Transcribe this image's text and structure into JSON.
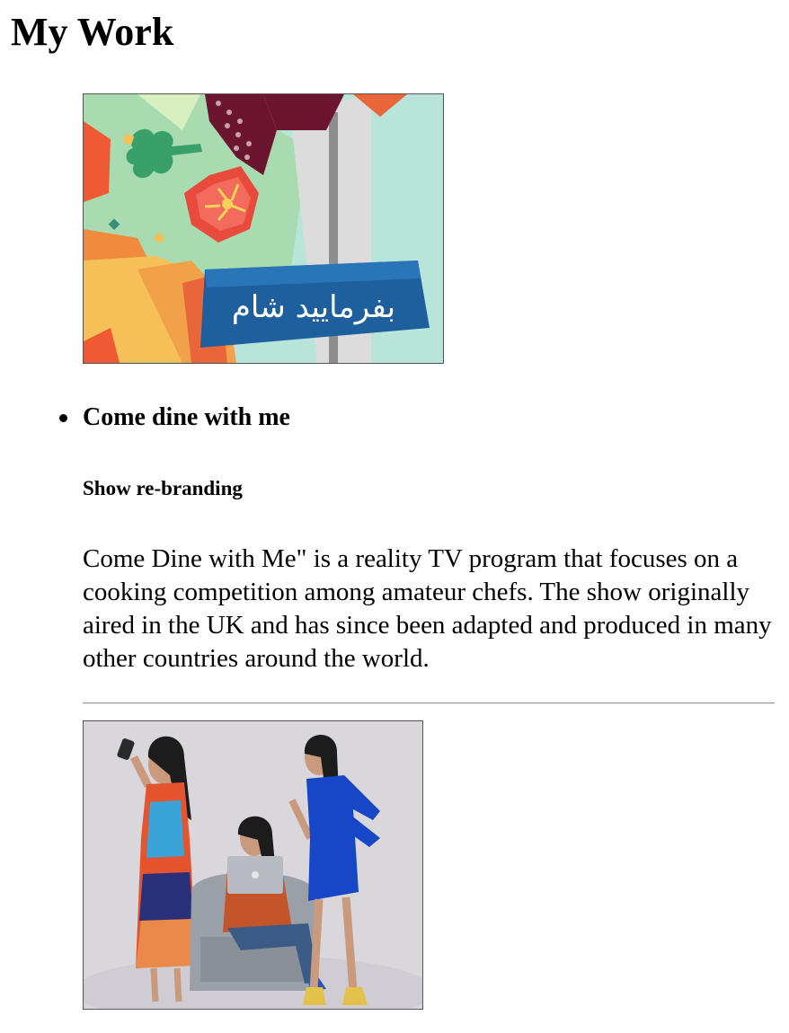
{
  "page": {
    "title": "My Work"
  },
  "works": [
    {
      "image": {
        "alt": "Come Dine with Me Persian logo artwork",
        "arabic_title": "بفرمایید شام",
        "colors": {
          "background": "#b9e4da",
          "banner": "#1e5f9e",
          "tomato": "#e84b3c",
          "orange": "#f08a3c",
          "maroon": "#6b1530",
          "leaf": "#3aa06a"
        }
      },
      "title": "Come dine with me",
      "subtitle": "Show re-branding",
      "description": "Come Dine with Me\" is a reality TV program that focuses on a cooking competition among amateur chefs. The show originally aired in the UK and has since been adapted and produced in many other countries around the world."
    },
    {
      "image": {
        "alt": "Three hosts posing: one taking a selfie, one seated with a laptop, one in a blue dress",
        "colors": {
          "backdrop": "#d9d6dc",
          "dress_blue": "#1747c7",
          "chair": "#9aa0a8",
          "patterned_dress": "#e4552f"
        }
      }
    }
  ]
}
